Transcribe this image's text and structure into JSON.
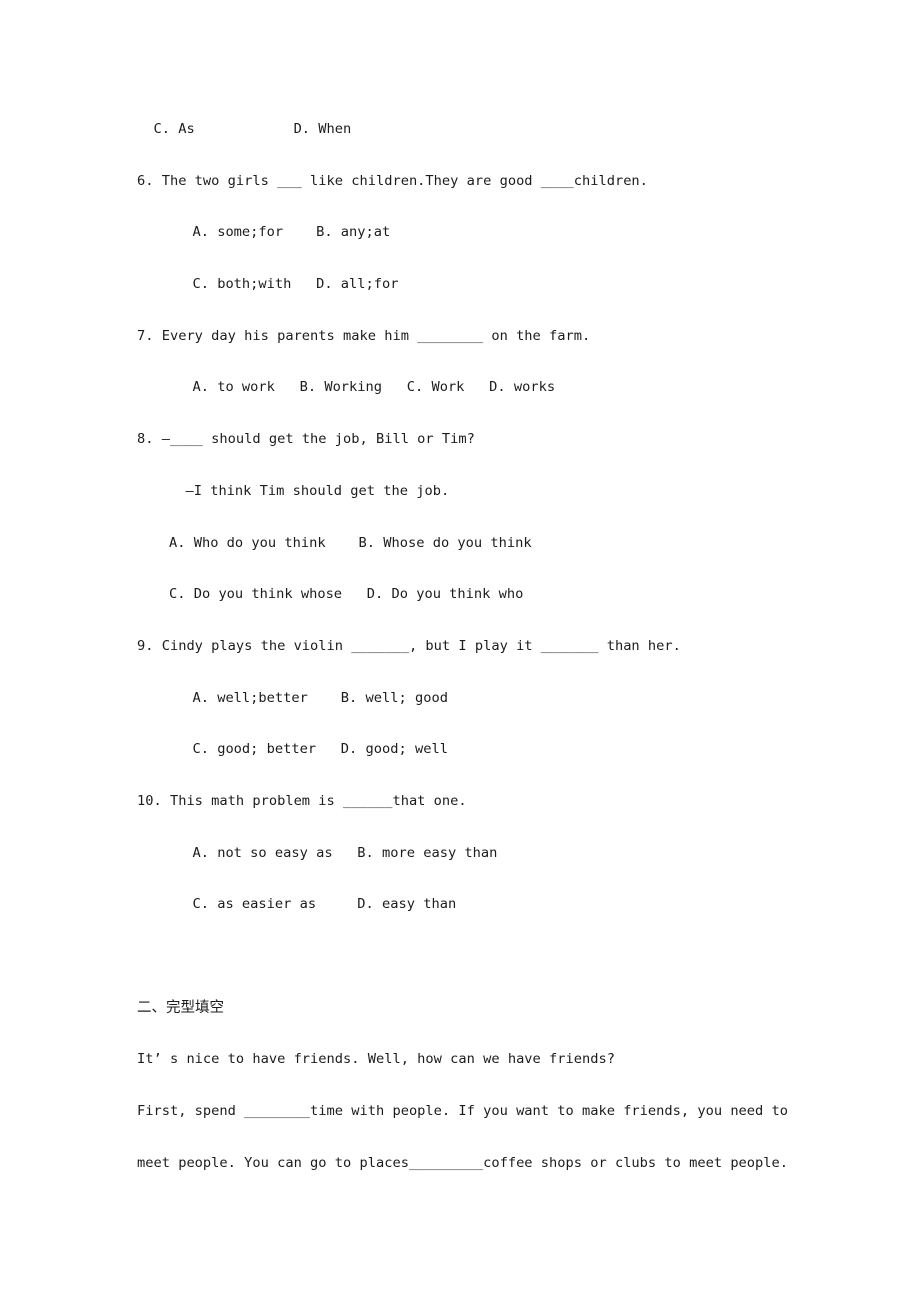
{
  "document": {
    "type": "english-exercise-worksheet",
    "background_color": "#ffffff",
    "text_color": "#1c1c1c"
  },
  "section_one_tail": {
    "q5_options_line": "  C. As            D. When",
    "questions": [
      {
        "number": "6",
        "stem": "6. The two girls ___ like children.They are good ____children.",
        "option_lines": [
          "  A. some;for    B. any;at",
          "  C. both;with   D. all;for"
        ]
      },
      {
        "number": "7",
        "stem": "7. Every day his parents make him ________ on the farm.",
        "option_lines": [
          "  A. to work   B. Working   C. Work   D. works"
        ]
      },
      {
        "number": "8",
        "stem": "8. —____ should get the job, Bill or Tim?",
        "dialogue_line": "  —I think Tim should get the job.",
        "option_lines": [
          "A. Who do you think    B. Whose do you think",
          "C. Do you think whose   D. Do you think who"
        ]
      },
      {
        "number": "9",
        "stem": "9. Cindy plays the violin _______, but I play it _______ than her.",
        "option_lines": [
          "  A. well;better    B. well; good",
          "  C. good; better   D. good; well"
        ]
      },
      {
        "number": "10",
        "stem": "10. This math problem is ______that one.",
        "option_lines": [
          "  A. not so easy as   B. more easy than",
          "  C. as easier as     D. easy than"
        ]
      }
    ]
  },
  "section_two": {
    "heading": "二、完型填空",
    "passage_lines": [
      "It’ s nice to have friends. Well, how can we have friends?",
      "First, spend ________time with people. If you want to make friends, you need to",
      "meet people. You can go to places_________coffee shops or clubs to meet people."
    ]
  }
}
